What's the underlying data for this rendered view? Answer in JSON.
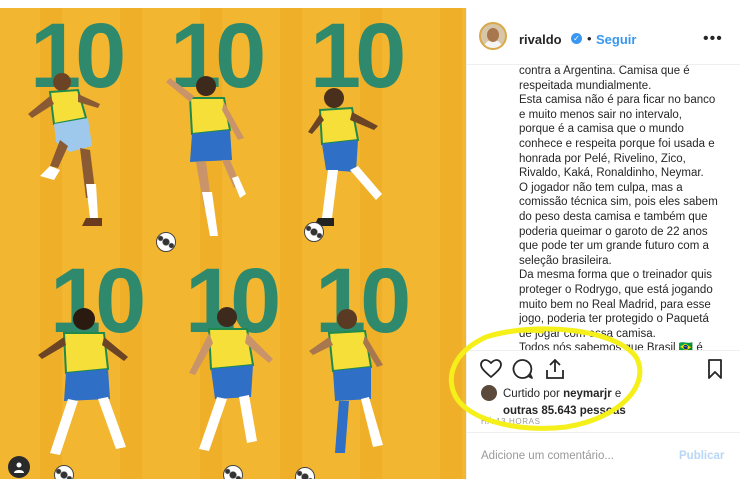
{
  "post": {
    "username": "rivaldo",
    "separator": "•",
    "follow_label": "Seguir",
    "more_icon": "more-options-icon"
  },
  "media": {
    "jersey_number": "10",
    "background_color": "#f2b630",
    "number_color": "#2f8a6d"
  },
  "caption": {
    "lines": [
      "contra a Argentina. Camisa que é",
      "respeitada mundialmente.",
      "Esta camisa não é para ficar no banco",
      "e muito menos sair no intervalo,",
      "porque é a camisa que o mundo",
      "conhece e respeita porque foi usada e",
      "honrada por Pelé, Rivelino, Zico,",
      "Rivaldo, Kaká, Ronaldinho, Neymar.",
      "O jogador não tem culpa, mas a",
      "comissão técnica sim, pois eles sabem",
      "do peso desta camisa e também que",
      "poderia queimar o garoto de 22 anos",
      "que pode ter um grande futuro com a",
      "seleção brasileira.",
      "Da mesma forma que o treinador quis",
      "proteger o Rodrygo, que está jogando",
      "muito bem no Real Madrid, para esse",
      "jogo, poderia ter protegido o Paquetá",
      "de jogar com essa camisa.",
      "Todos nós sabemos que Brasil 🇧🇷 é"
    ]
  },
  "likes": {
    "prefix": "Curtido por ",
    "liker": "neymarjr",
    "suffix": " e",
    "others": "outras 85.643 pessoas"
  },
  "timestamp": "HÁ 13 HORAS",
  "comment": {
    "placeholder": "Adicione um comentário...",
    "publish_label": "Publicar"
  },
  "colors": {
    "accent": "#3897f0",
    "highlight": "#f5ef1a"
  }
}
